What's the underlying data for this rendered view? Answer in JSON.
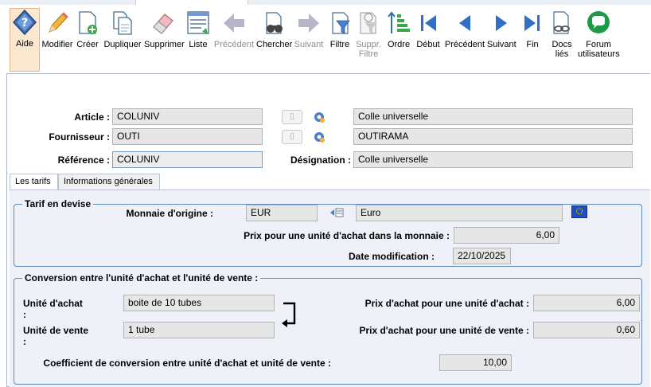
{
  "toolbar": {
    "items": [
      {
        "id": "aide",
        "label": "Aide",
        "icon": "help-diamond-icon",
        "active": true
      },
      {
        "id": "modifier",
        "label": "Modifier",
        "icon": "pencil-icon"
      },
      {
        "id": "creer",
        "label": "Créer",
        "icon": "new-document-icon"
      },
      {
        "id": "dupliquer",
        "label": "Dupliquer",
        "icon": "duplicate-icon"
      },
      {
        "id": "supprimer",
        "label": "Supprimer",
        "icon": "eraser-icon"
      },
      {
        "id": "liste",
        "label": "Liste",
        "icon": "list-icon"
      },
      {
        "id": "precedent1",
        "label": "Précédent",
        "icon": "arrow-left-icon",
        "disabled": true
      },
      {
        "id": "chercher",
        "label": "Chercher",
        "icon": "binoculars-icon"
      },
      {
        "id": "suivant1",
        "label": "Suivant",
        "icon": "arrow-right-icon",
        "disabled": true
      },
      {
        "id": "filtre",
        "label": "Filtre",
        "icon": "filter-icon"
      },
      {
        "id": "supprfiltre",
        "label": "Suppr. Filtre",
        "icon": "remove-filter-icon",
        "disabled": true
      },
      {
        "id": "ordre",
        "label": "Ordre",
        "icon": "sort-order-icon"
      },
      {
        "id": "debut",
        "label": "Début",
        "icon": "first-record-icon"
      },
      {
        "id": "precedent2",
        "label": "Précédent",
        "icon": "previous-record-icon"
      },
      {
        "id": "suivant2",
        "label": "Suivant",
        "icon": "next-record-icon"
      },
      {
        "id": "fin",
        "label": "Fin",
        "icon": "last-record-icon"
      },
      {
        "id": "docs",
        "label": "Docs liés",
        "icon": "linked-docs-icon"
      },
      {
        "id": "forum",
        "label": "Forum utilisateurs",
        "icon": "forum-chat-icon"
      }
    ]
  },
  "header": {
    "article_label": "Article :",
    "article_code": "COLUNIV",
    "article_name": "Colle universelle",
    "fournisseur_label": "Fournisseur :",
    "fournisseur_code": "OUTI",
    "fournisseur_name": "OUTIRAMA",
    "reference_label": "Référence :",
    "reference_value": "COLUNIV",
    "designation_label": "Désignation :",
    "designation_value": "Colle universelle"
  },
  "tabs": [
    {
      "label": "Les tarifs",
      "selected": true
    },
    {
      "label": "Informations générales",
      "selected": false
    }
  ],
  "tarif": {
    "title": "Tarif en devise",
    "monnaie_label": "Monnaie d'origine :",
    "monnaie_code": "EUR",
    "monnaie_name": "Euro",
    "prix_label": "Prix pour une unité d'achat dans la monnaie :",
    "prix_value": "6,00",
    "date_label": "Date modification :",
    "date_value": "22/10/2025"
  },
  "conversion": {
    "title": "Conversion entre l'unité d'achat et l'unité de vente :",
    "unite_achat_label": "Unité d'achat :",
    "unite_achat_value": "boite de 10 tubes",
    "unite_vente_label": "Unité de vente :",
    "unite_vente_value": "1 tube",
    "prix_achat_ua_label": "Prix d'achat pour une unité d'achat :",
    "prix_achat_ua_value": "6,00",
    "prix_achat_uv_label": "Prix d'achat pour une unité de vente :",
    "prix_achat_uv_value": "0,60",
    "coef_label": "Coefficient de conversion entre unité d'achat et unité de vente :",
    "coef_value": "10,00"
  },
  "colors": {
    "accent": "#3a7bd5",
    "group_border": "#5d88b8",
    "active_button": "#fbe6cf",
    "forum_green": "#1e9a46"
  }
}
